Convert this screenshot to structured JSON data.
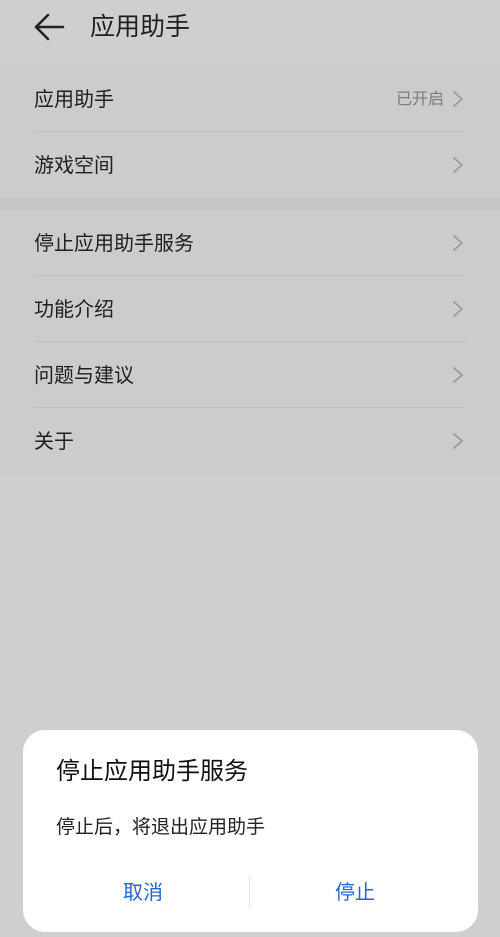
{
  "header": {
    "back_icon": "arrow-left-icon",
    "title": "应用助手"
  },
  "settings": {
    "group1": [
      {
        "label": "应用助手",
        "value": "已开启"
      },
      {
        "label": "游戏空间",
        "value": ""
      }
    ],
    "group2": [
      {
        "label": "停止应用助手服务"
      },
      {
        "label": "功能介绍"
      },
      {
        "label": "问题与建议"
      },
      {
        "label": "关于"
      }
    ]
  },
  "dialog": {
    "title": "停止应用助手服务",
    "message": "停止后，将退出应用助手",
    "cancel_label": "取消",
    "confirm_label": "停止"
  },
  "colors": {
    "background": "#cfcfcf",
    "dialog_background": "#ffffff",
    "accent": "#1f67d1",
    "text_primary": "#1f1f1f",
    "text_secondary": "#7d7d7d"
  }
}
